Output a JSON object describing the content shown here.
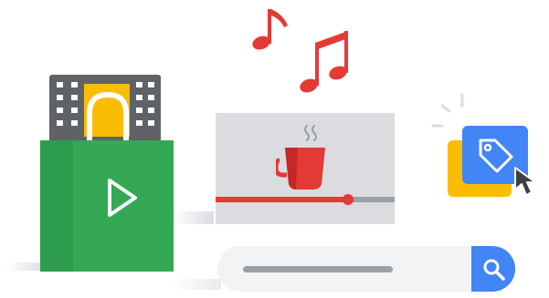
{
  "illustration": {
    "music_notes": {
      "icon": "music-note-icon",
      "color": "#e53935"
    },
    "shopping_bag": {
      "icon": "play-icon",
      "bag_color": "#34a853",
      "film_color": "#5f6368",
      "ticket_color": "#fbbc04"
    },
    "video_player": {
      "screen_color": "#dadce0",
      "cup_icon": "coffee-cup-icon",
      "cup_color": "#e53935",
      "progress": 0.74,
      "progress_color": "#e53935"
    },
    "search_bar": {
      "icon": "search-icon",
      "button_color": "#4285f4",
      "field_color": "#f1f3f4"
    },
    "tag_card": {
      "icon": "tag-icon",
      "card_color": "#4285f4",
      "back_card_color": "#fbbc04",
      "cursor": "cursor-arrow-icon"
    }
  }
}
